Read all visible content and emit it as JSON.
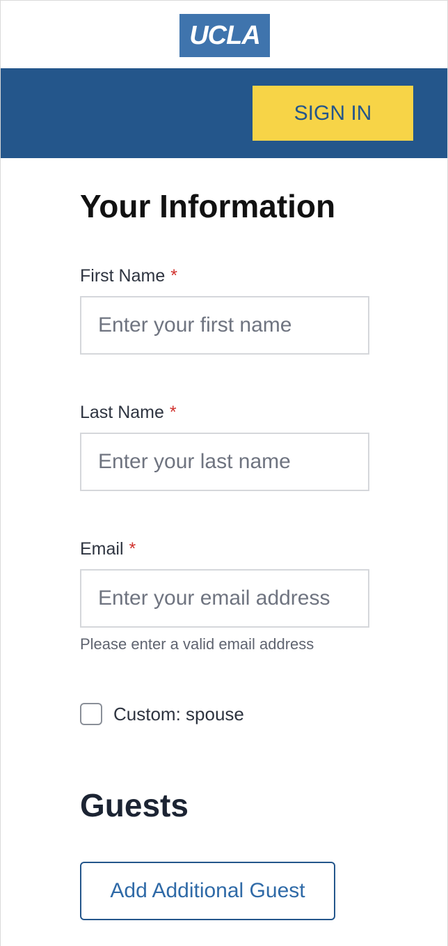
{
  "header": {
    "logo_text": "UCLA",
    "signin_label": "SIGN IN"
  },
  "colors": {
    "brand_blue": "#24568b",
    "logo_blue": "#3f74ad",
    "accent_yellow": "#f7d447",
    "required_red": "#d0312d"
  },
  "form": {
    "title": "Your Information",
    "first_name": {
      "label": "First Name",
      "required_mark": "*",
      "placeholder": "Enter your first name"
    },
    "last_name": {
      "label": "Last Name",
      "required_mark": "*",
      "placeholder": "Enter your last name"
    },
    "email": {
      "label": "Email",
      "required_mark": "*",
      "placeholder": "Enter your email address",
      "help": "Please enter a valid email address"
    },
    "custom_checkbox": {
      "label": "Custom: spouse",
      "checked": false
    }
  },
  "guests": {
    "title": "Guests",
    "add_button_label": "Add Additional Guest"
  }
}
